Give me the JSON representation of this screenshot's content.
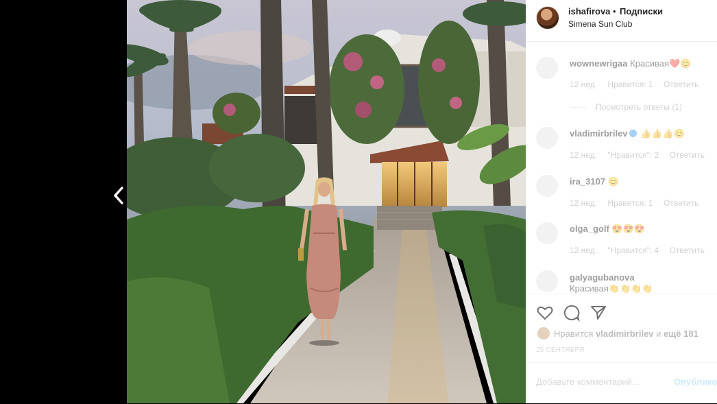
{
  "post": {
    "username": "ishafirova",
    "separator": "•",
    "follow_label": "Подписки",
    "location": "Simena Sun Club"
  },
  "comments": [
    {
      "user": "wownewrigaa",
      "text": "Красивая❤️😊",
      "time": "12 нед.",
      "likes": "Нравится: 1",
      "reply": "Ответить"
    },
    {
      "user": "vladimirbrilev",
      "text": "👍👍👍😊",
      "time": "12 нед.",
      "likes": "\"Нравится\": 2",
      "reply": "Ответить"
    },
    {
      "user": "ira_3107",
      "text": "😊",
      "time": "12 нед.",
      "likes": "Нравится: 1",
      "reply": "Ответить"
    },
    {
      "user": "olga_golf",
      "text": "😍😍😍",
      "time": "12 нед.",
      "likes": "\"Нравится\": 4",
      "reply": "Ответить"
    },
    {
      "user": "galyagubanova",
      "text": "Красивая👏👏👏👏",
      "time": "",
      "likes": "",
      "reply": ""
    }
  ],
  "view_replies": "Посмотреть ответы (1)",
  "likes_summary": {
    "prefix": "Нравится",
    "user": "vladimirbrilev",
    "middle": "и",
    "rest": "ещё 181"
  },
  "date": "25 СЕНТЯБРЯ",
  "add_comment": {
    "placeholder": "Добавьте комментарий...",
    "post_label": "Опубликовать"
  },
  "icons": {
    "prev": "chevron-left-icon",
    "like": "heart-icon",
    "comment": "comment-bubble-icon",
    "share": "paper-plane-icon",
    "verified": "verified-badge-icon"
  }
}
